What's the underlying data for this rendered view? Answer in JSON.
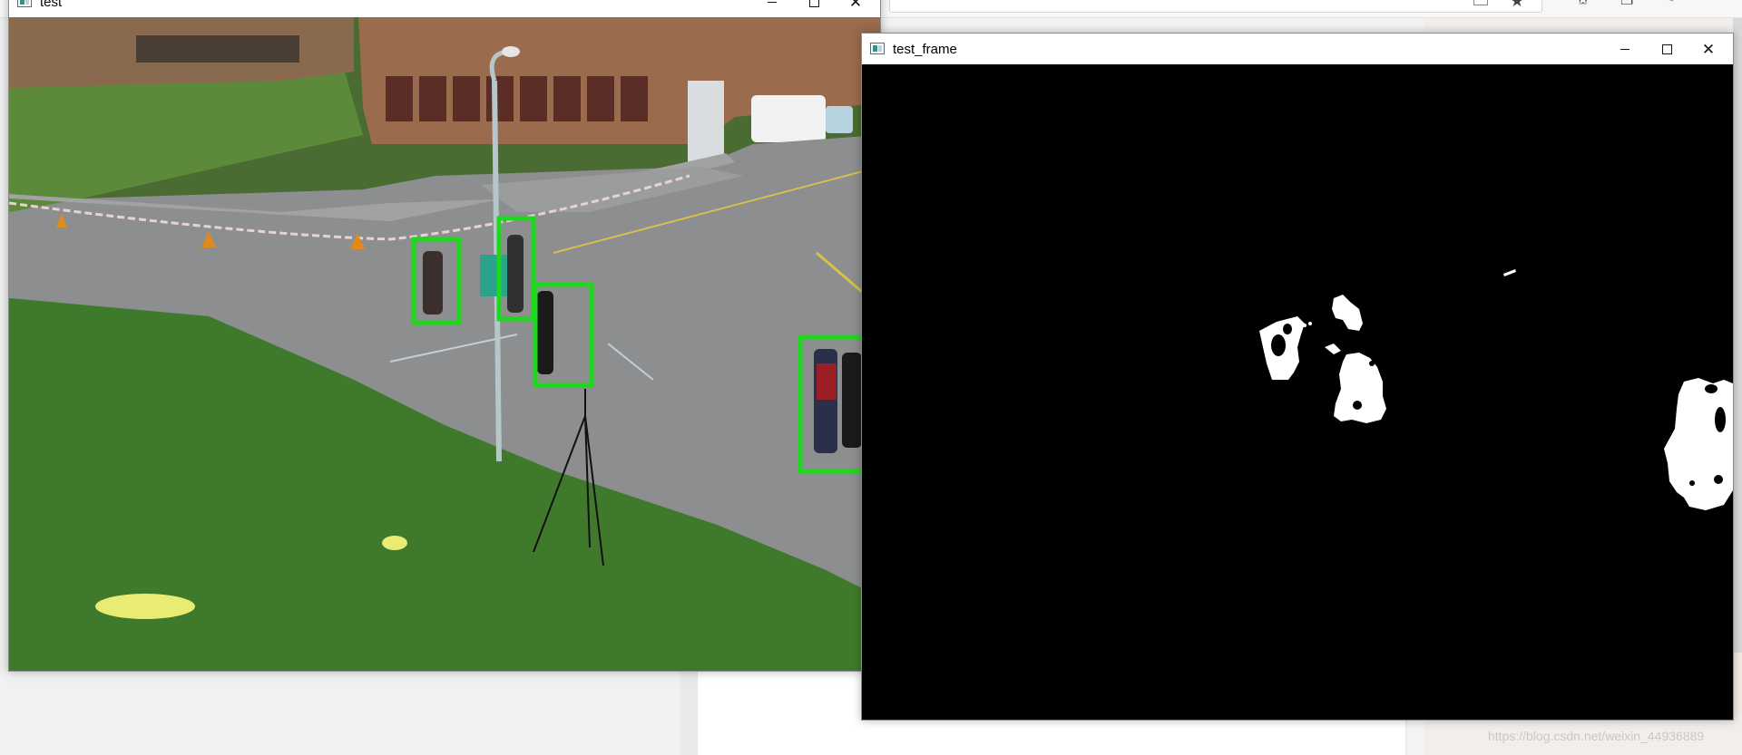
{
  "windows": [
    {
      "id": "test",
      "title": "test",
      "controls": [
        "minimize",
        "maximize",
        "close"
      ],
      "content": "camera-frame",
      "detections": [
        {
          "label": "person"
        },
        {
          "label": "person"
        },
        {
          "label": "person"
        },
        {
          "label": "people-group"
        }
      ],
      "box_color": "#1ed81e"
    },
    {
      "id": "test_frame",
      "title": "test_frame",
      "controls": [
        "minimize",
        "maximize",
        "close"
      ],
      "content": "foreground-mask",
      "mask_background": "#000000",
      "mask_foreground": "#ffffff"
    }
  ],
  "icons": {
    "window_app": "opencv-window-icon",
    "minimize": "minimize-icon",
    "maximize": "maximize-icon",
    "close": "close-icon",
    "bookmark": "star-icon"
  },
  "glyphs": {
    "close": "✕",
    "star": "★"
  },
  "watermark": "https://blog.csdn.net/weixin_44936889"
}
